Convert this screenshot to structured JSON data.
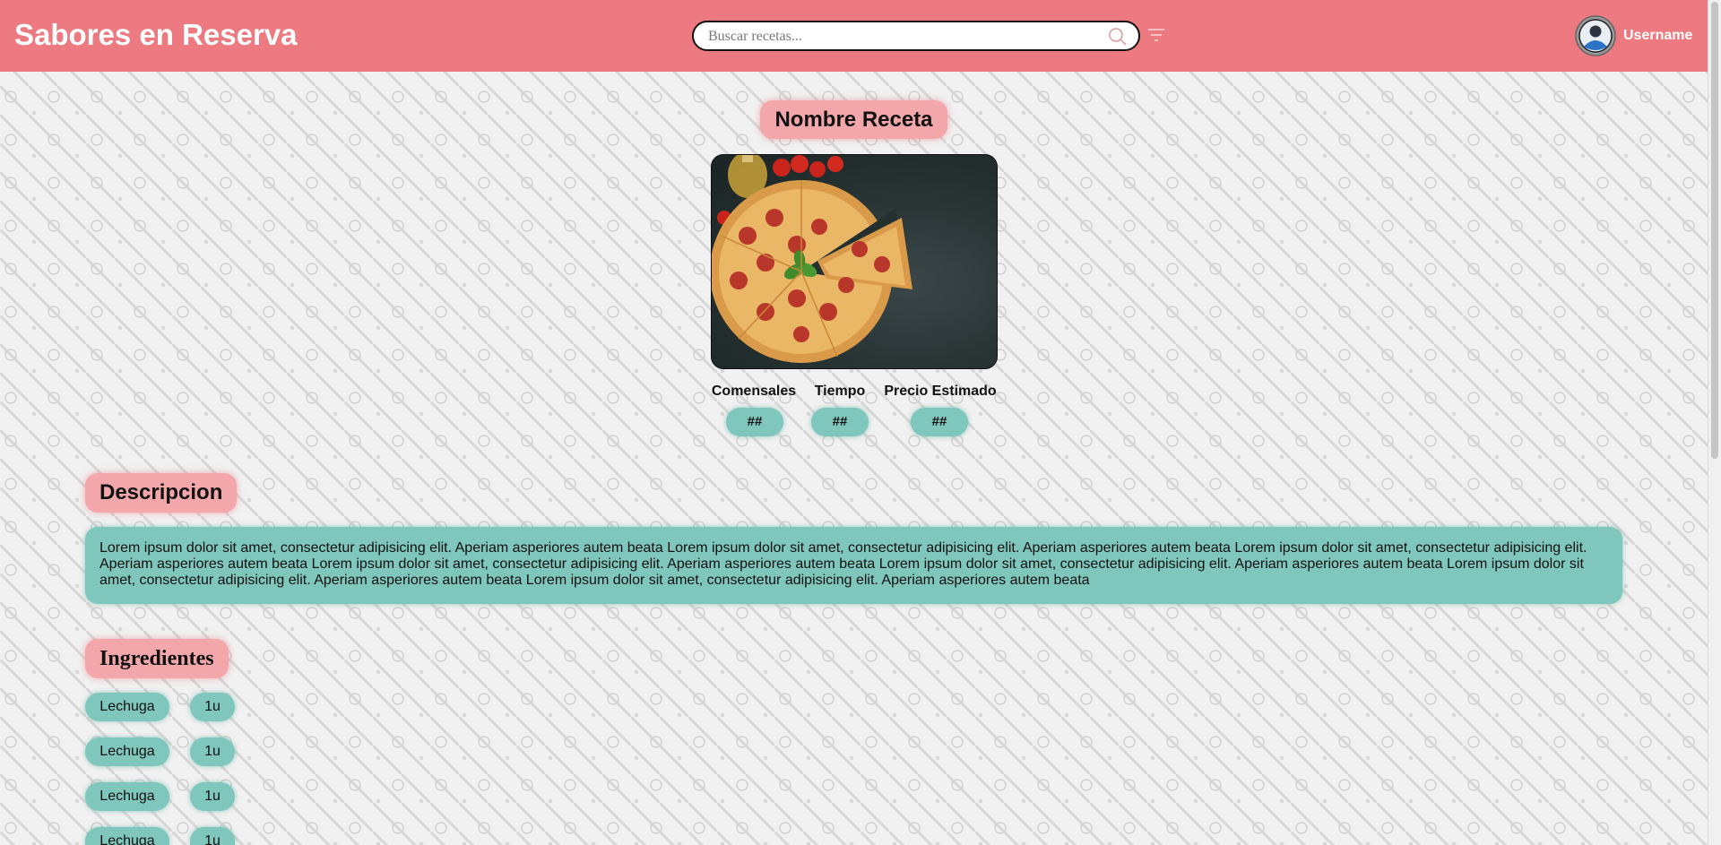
{
  "header": {
    "brand": "Sabores en Reserva",
    "search_placeholder": "Buscar recetas...",
    "username": "Username"
  },
  "recipe": {
    "title": "Nombre Receta",
    "image_alt": "pizza",
    "stats": [
      {
        "label": "Comensales",
        "value": "##"
      },
      {
        "label": "Tiempo",
        "value": "##"
      },
      {
        "label": "Precio Estimado",
        "value": "##"
      }
    ]
  },
  "description": {
    "title": "Descripcion",
    "text": "Lorem ipsum dolor sit amet, consectetur adipisicing elit. Aperiam asperiores autem beata Lorem ipsum dolor sit amet, consectetur adipisicing elit. Aperiam asperiores autem beata Lorem ipsum dolor sit amet, consectetur adipisicing elit. Aperiam asperiores autem beata Lorem ipsum dolor sit amet, consectetur adipisicing elit. Aperiam asperiores autem beata Lorem ipsum dolor sit amet, consectetur adipisicing elit. Aperiam asperiores autem beata Lorem ipsum dolor sit amet, consectetur adipisicing elit. Aperiam asperiores autem beata Lorem ipsum dolor sit amet, consectetur adipisicing elit. Aperiam asperiores autem beata"
  },
  "ingredients": {
    "title": "Ingredientes",
    "items": [
      {
        "name": "Lechuga",
        "qty": "1u"
      },
      {
        "name": "Lechuga",
        "qty": "1u"
      },
      {
        "name": "Lechuga",
        "qty": "1u"
      },
      {
        "name": "Lechuga",
        "qty": "1u"
      }
    ]
  },
  "colors": {
    "header_bg": "#ec7a80",
    "pink_pill": "#f3a7ab",
    "teal_pill": "#7fc6bc"
  },
  "icons": [
    "search-icon",
    "filter-icon",
    "user-avatar-icon"
  ]
}
